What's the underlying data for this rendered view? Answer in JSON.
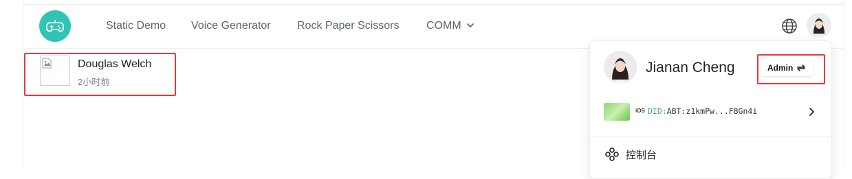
{
  "nav": {
    "logo_icon": "gamepad-icon",
    "links": [
      "Static Demo",
      "Voice Generator",
      "Rock Paper Scissors",
      "COMM"
    ],
    "language_icon": "globe-icon"
  },
  "list": {
    "items": [
      {
        "title": "Douglas Welch",
        "time": "2小时前"
      }
    ]
  },
  "user_menu": {
    "name": "Jianan Cheng",
    "role": "Admin",
    "role_icon": "switch-arrows-icon",
    "did": {
      "os": "iOS",
      "prefix": "DID:",
      "value": "ABT:z1kmPw...F8Gn4i"
    },
    "console_label": "控制台"
  },
  "colors": {
    "brand": "#2ec4b6",
    "highlight": "#e53935",
    "did_prefix": "#4caf50"
  }
}
